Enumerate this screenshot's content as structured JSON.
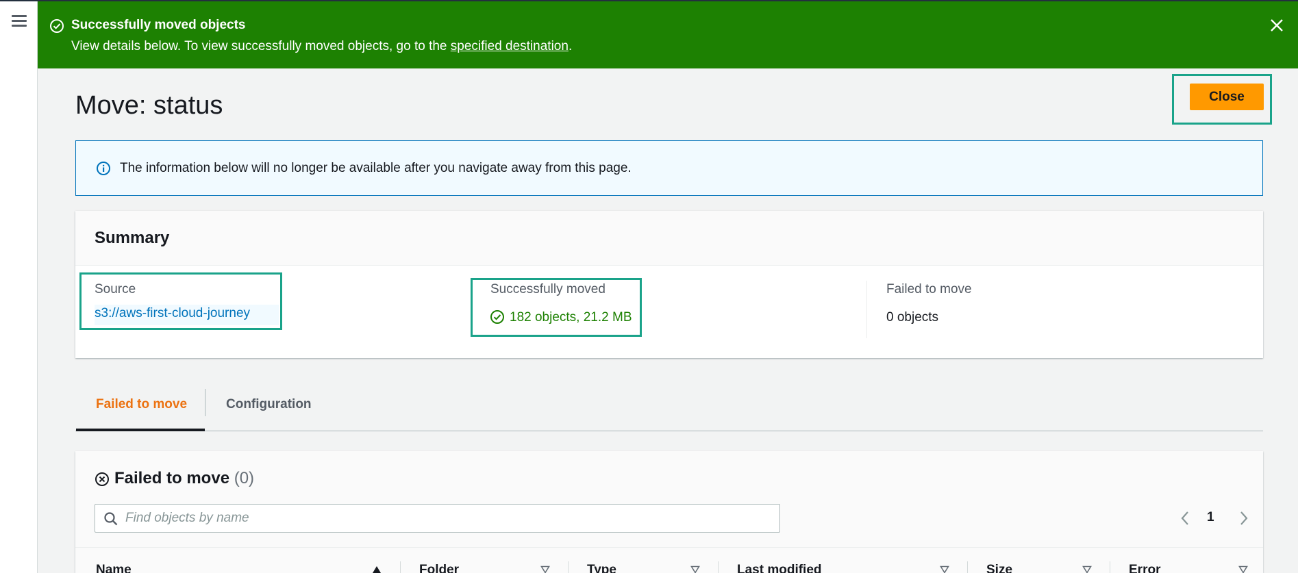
{
  "flash": {
    "title": "Successfully moved objects",
    "text_before": "View details below. To view successfully moved objects, go to the ",
    "link": "specified destination",
    "text_after": ".",
    "color": "#1d8102"
  },
  "page": {
    "title": "Move: status",
    "close_label": "Close"
  },
  "info": {
    "text": "The information below will no longer be available after you navigate away from this page."
  },
  "summary": {
    "title": "Summary",
    "source_label": "Source",
    "source_value": "s3://aws-first-cloud-journey",
    "moved_label": "Successfully moved",
    "moved_value": "182 objects, 21.2 MB",
    "failed_label": "Failed to move",
    "failed_value": "0 objects"
  },
  "tabs": [
    {
      "label": "Failed to move",
      "active": true
    },
    {
      "label": "Configuration",
      "active": false
    }
  ],
  "failed": {
    "title": "Failed to move",
    "count": "(0)",
    "search_placeholder": "Find objects by name",
    "page_number": "1"
  },
  "table": {
    "columns": [
      "Name",
      "Folder",
      "Type",
      "Last modified",
      "Size",
      "Error"
    ]
  },
  "icons": {
    "menu": "hamburger-menu-icon",
    "flash_status": "success-check-circle-icon",
    "flash_dismiss": "close-icon",
    "info": "info-icon",
    "moved_status": "success-check-circle-icon",
    "failed_status": "error-x-circle-icon",
    "search": "search-icon",
    "prev": "chevron-left-icon",
    "next": "chevron-right-icon"
  },
  "colors": {
    "accent": "#ff9900",
    "success": "#1d8102",
    "link": "#0073bb",
    "tab_active": "#ec7211",
    "highlight": "#1aa38a"
  }
}
